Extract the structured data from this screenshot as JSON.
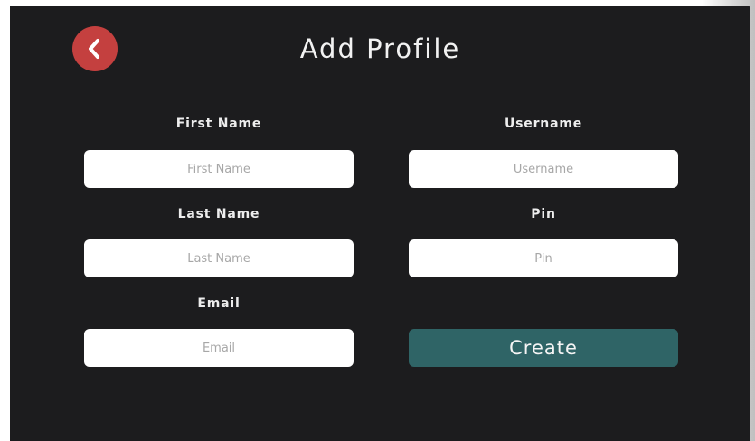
{
  "header": {
    "title": "Add Profile",
    "back_icon": "chevron-left-icon"
  },
  "form": {
    "first_name": {
      "label": "First Name",
      "placeholder": "First Name",
      "value": ""
    },
    "username": {
      "label": "Username",
      "placeholder": "Username",
      "value": ""
    },
    "last_name": {
      "label": "Last Name",
      "placeholder": "Last Name",
      "value": ""
    },
    "pin": {
      "label": "Pin",
      "placeholder": "Pin",
      "value": ""
    },
    "email": {
      "label": "Email",
      "placeholder": "Email",
      "value": ""
    },
    "create_label": "Create"
  },
  "colors": {
    "background": "#1c1c1e",
    "back_button": "#c4403f",
    "create_button": "#2f6466",
    "field_background": "#ffffff"
  }
}
